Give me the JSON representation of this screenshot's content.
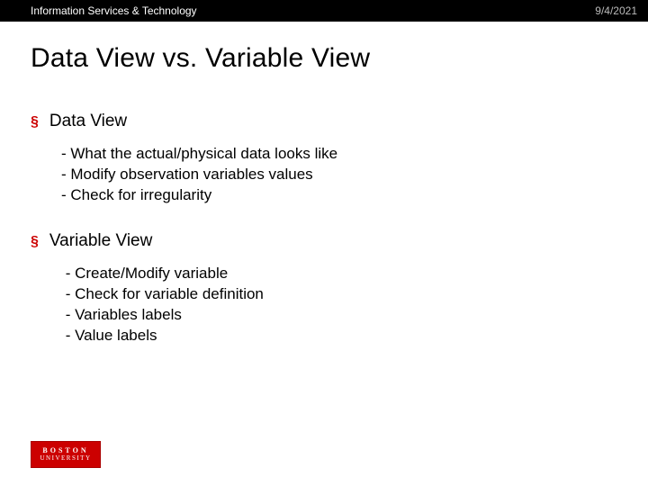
{
  "header": {
    "org": "Information Services & Technology",
    "date": "9/4/2021"
  },
  "title": "Data View vs. Variable View",
  "sections": [
    {
      "bullet": "§",
      "heading": "Data View",
      "items": [
        "- What the actual/physical data looks like",
        "- Modify observation variables values",
        "- Check for irregularity"
      ]
    },
    {
      "bullet": "§",
      "heading": "Variable View",
      "items": [
        " - Create/Modify variable",
        " - Check for variable definition",
        " - Variables labels",
        " - Value labels"
      ]
    }
  ],
  "logo": {
    "line1": "BOSTON",
    "line2": "UNIVERSITY"
  }
}
